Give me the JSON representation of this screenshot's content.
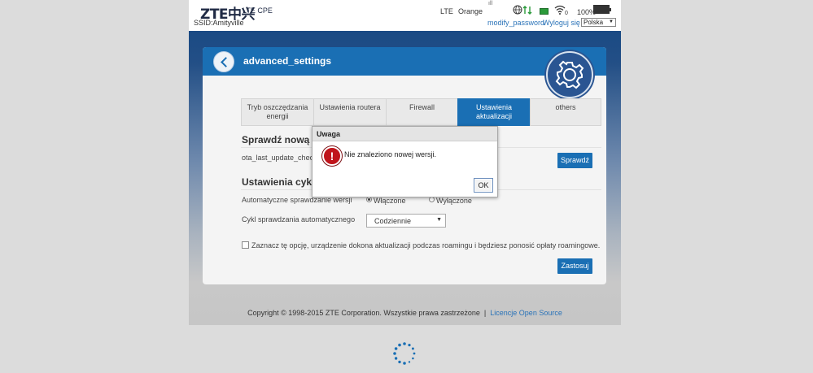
{
  "header": {
    "logo": "ZTE中兴",
    "product": "LTE CPE",
    "ssid": "SSID:Amityville",
    "network_type": "LTE",
    "carrier": "Orange",
    "signal_label": "ıll",
    "wifi_clients": "0",
    "battery": "100%",
    "modify_password": "modify_password",
    "logout": "Wyloguj się",
    "language": "Polska"
  },
  "page": {
    "title": "advanced_settings"
  },
  "tabs": [
    {
      "label": "Tryb oszczędzania energii",
      "active": false
    },
    {
      "label": "Ustawienia routera",
      "active": false
    },
    {
      "label": "Firewall",
      "active": false
    },
    {
      "label": "Ustawienia aktualizacji",
      "active": true
    },
    {
      "label": "others",
      "active": false
    }
  ],
  "check_section": {
    "title": "Sprawdź nową we",
    "label": "ota_last_update_check",
    "button": "Sprawdź"
  },
  "cycle_section": {
    "title": "Ustawienia cyklu",
    "auto_check_label": "Automatyczne sprawdzanie wersji",
    "option_on": "Włączone",
    "option_off": "Wyłączone",
    "selected": "on",
    "cycle_label": "Cykl sprawdzania automatycznego",
    "cycle_value": "Codziennie",
    "roaming_text": "Zaznacz tę opcję, urządzenie dokona aktualizacji podczas roamingu i będziesz ponosić opłaty roamingowe.",
    "roaming_checked": false,
    "apply_button": "Zastosuj"
  },
  "footer": {
    "copyright": "Copyright © 1998-2015 ZTE Corporation. Wszystkie prawa zastrzeżone",
    "separator": "|",
    "link": "Licencje Open Source"
  },
  "modal": {
    "title": "Uwaga",
    "message": "Nie znaleziono nowej wersji.",
    "ok": "OK"
  },
  "colors": {
    "accent": "#1a6fb4",
    "header_band": "#1a4a84",
    "warning": "#c0141b"
  }
}
